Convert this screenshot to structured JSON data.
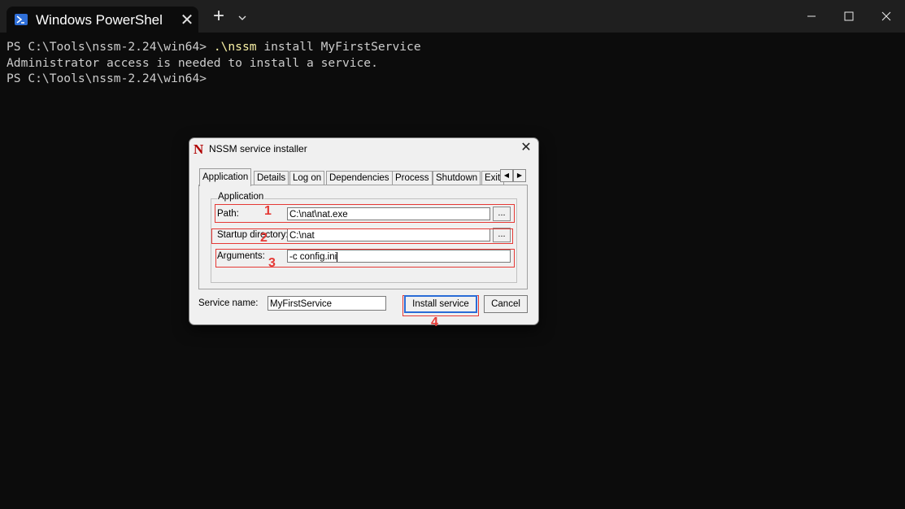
{
  "window": {
    "tab_title": "Windows PowerShel",
    "tab_close": "✕",
    "new_tab": "+"
  },
  "terminal": {
    "line1_prompt": "PS C:\\Tools\\nssm-2.24\\win64> ",
    "line1_cmd": ".\\nssm",
    "line1_args": " install MyFirstService",
    "line2": "Administrator access is needed to install a service.",
    "line3": "PS C:\\Tools\\nssm-2.24\\win64>"
  },
  "dialog": {
    "logo": "N",
    "title": "NSSM service installer",
    "close": "✕",
    "tabs": [
      "Application",
      "Details",
      "Log on",
      "Dependencies",
      "Process",
      "Shutdown",
      "Exit"
    ],
    "group_label": "Application",
    "path_label": "Path:",
    "path_value": "C:\\nat\\nat.exe",
    "startup_label": "Startup directory:",
    "startup_value": "C:\\nat",
    "args_label": "Arguments:",
    "args_value": "-c config.ini",
    "browse": "...",
    "service_name_label": "Service name:",
    "service_name_value": "MyFirstService",
    "install_button": "Install service",
    "cancel_button": "Cancel"
  },
  "annotations": {
    "n1": "1",
    "n2": "2",
    "n3": "3",
    "n4": "4"
  }
}
